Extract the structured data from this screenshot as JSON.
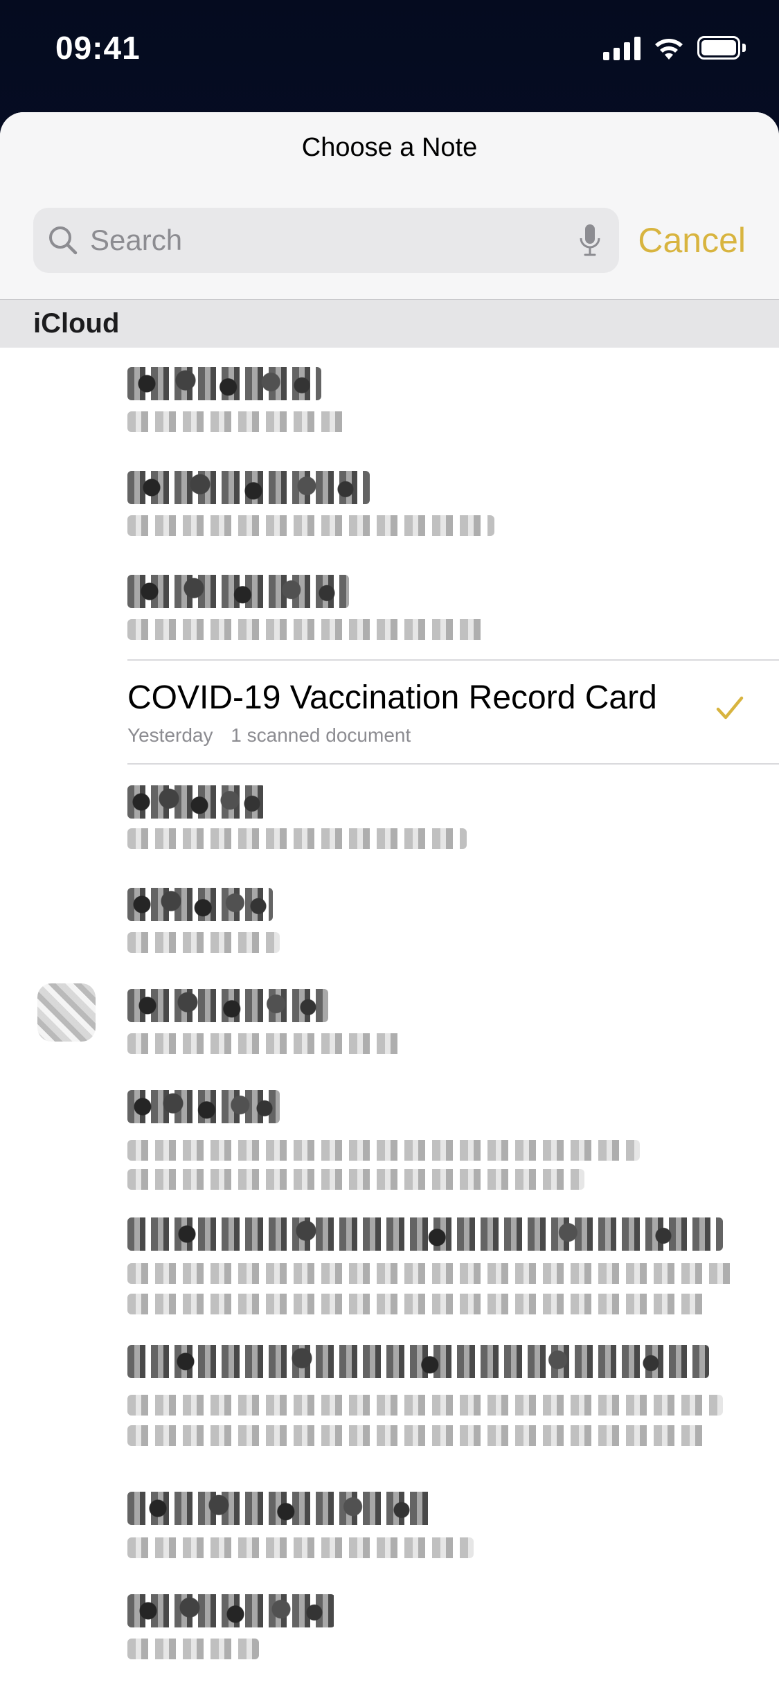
{
  "status_bar": {
    "time": "09:41"
  },
  "sheet": {
    "title": "Choose a Note",
    "search": {
      "placeholder": "Search",
      "value": ""
    },
    "cancel_label": "Cancel",
    "section_label": "iCloud"
  },
  "selected_note": {
    "title": "COVID-19 Vaccination Record Card",
    "date": "Yesterday",
    "detail": "1 scanned document"
  },
  "colors": {
    "accent": "#d8b43f",
    "sheet_background": "#f6f6f7",
    "section_background": "#e5e5e7"
  },
  "icons": {
    "search": "magnifying-glass",
    "microphone": "mic",
    "selected": "checkmark",
    "signal": "cellular-bars",
    "wifi": "wifi",
    "battery": "battery-full"
  }
}
